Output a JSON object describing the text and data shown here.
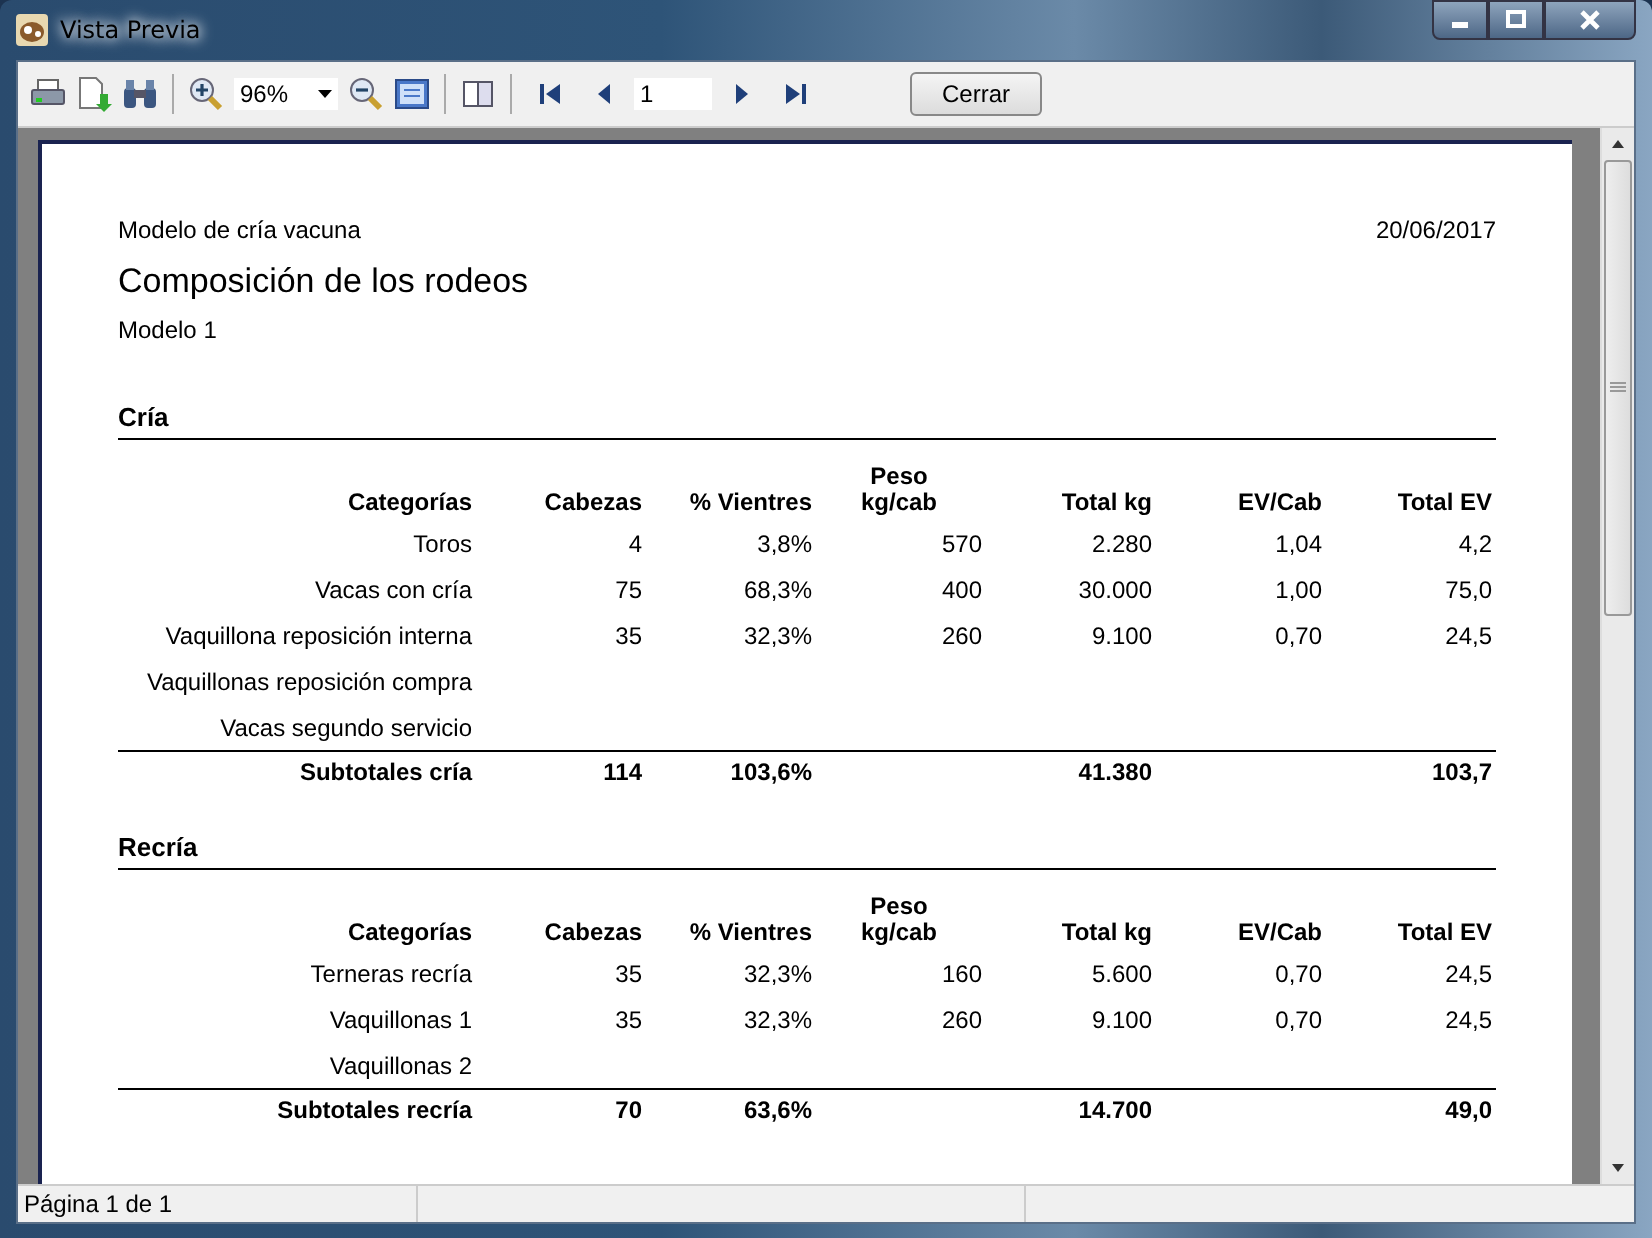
{
  "window": {
    "title": "Vista Previa"
  },
  "toolbar": {
    "zoom": "96%",
    "page": "1",
    "close_button": "Cerrar"
  },
  "report": {
    "subtitle": "Modelo de cría vacuna",
    "date": "20/06/2017",
    "title": "Composición de los rodeos",
    "model": "Modelo 1",
    "sections": [
      {
        "title": "Cría",
        "columns": [
          "Categorías",
          "Cabezas",
          "% Vientres",
          "Peso\nkg/cab",
          "Total kg",
          "EV/Cab",
          "Total EV"
        ],
        "rows": [
          [
            "Toros",
            "4",
            "3,8%",
            "570",
            "2.280",
            "1,04",
            "4,2"
          ],
          [
            "Vacas con cría",
            "75",
            "68,3%",
            "400",
            "30.000",
            "1,00",
            "75,0"
          ],
          [
            "Vaquillona reposición interna",
            "35",
            "32,3%",
            "260",
            "9.100",
            "0,70",
            "24,5"
          ],
          [
            "Vaquillonas reposición compra"
          ],
          [
            "Vacas segundo servicio"
          ]
        ],
        "subtotal": {
          "label": "Subtotales cría",
          "cabezas": "114",
          "vientres": "103,6%",
          "total_kg": "41.380",
          "total_ev": "103,7"
        }
      },
      {
        "title": "Recría",
        "columns": [
          "Categorías",
          "Cabezas",
          "% Vientres",
          "Peso\nkg/cab",
          "Total kg",
          "EV/Cab",
          "Total EV"
        ],
        "rows": [
          [
            "Terneras recría",
            "35",
            "32,3%",
            "160",
            "5.600",
            "0,70",
            "24,5"
          ],
          [
            "Vaquillonas 1",
            "35",
            "32,3%",
            "260",
            "9.100",
            "0,70",
            "24,5"
          ],
          [
            "Vaquillonas 2"
          ]
        ],
        "subtotal": {
          "label": "Subtotales recría",
          "cabezas": "70",
          "vientres": "63,6%",
          "total_kg": "14.700",
          "total_ev": "49,0"
        }
      }
    ]
  },
  "status_bar": {
    "text": "Página 1 de 1"
  }
}
